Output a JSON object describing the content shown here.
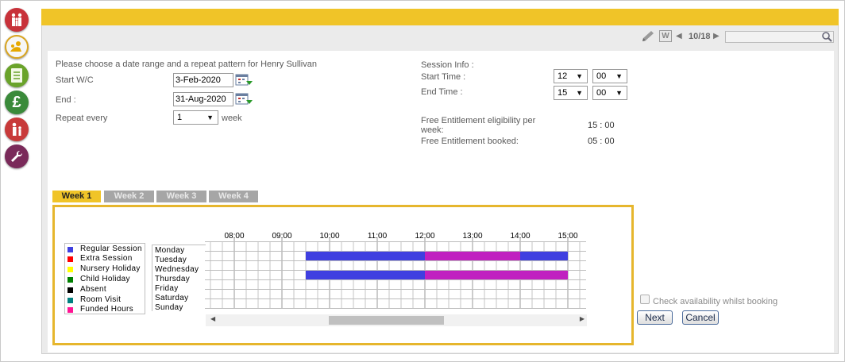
{
  "nav": {
    "items": [
      "family-icon",
      "child-icon",
      "register-icon",
      "finance-icon",
      "staff-icon",
      "settings-icon"
    ],
    "colors": [
      "#c8323a",
      "#f0c428",
      "#6aa32a",
      "#3a8a3a",
      "#c83a3a",
      "#7a2a5a"
    ]
  },
  "toolbar": {
    "page_counter": "10/18",
    "search_value": ""
  },
  "form": {
    "intro": "Please choose a date range and a repeat pattern for Henry Sullivan",
    "start_label": "Start W/C",
    "start_value": "3-Feb-2020",
    "end_label": "End :",
    "end_value": "31-Aug-2020",
    "repeat_label": "Repeat every",
    "repeat_value": "1",
    "repeat_unit": "week"
  },
  "session": {
    "title": "Session Info :",
    "start_label": "Start Time :",
    "start_hour": "12",
    "start_min": "00",
    "end_label": "End Time :",
    "end_hour": "15",
    "end_min": "00",
    "eligibility_label": "Free Entitlement eligibility per week:",
    "eligibility_value": "15 : 00",
    "booked_label": "Free Entitlement booked:",
    "booked_value": "05 : 00"
  },
  "tabs": [
    "Week 1",
    "Week 2",
    "Week 3",
    "Week 4"
  ],
  "active_tab": 0,
  "legend": [
    {
      "label": "Regular Session",
      "color": "#3f3fe0"
    },
    {
      "label": "Extra Session",
      "color": "#ff0000"
    },
    {
      "label": "Nursery Holiday",
      "color": "#ffff00"
    },
    {
      "label": "Child Holiday",
      "color": "#008000"
    },
    {
      "label": "Absent",
      "color": "#000000"
    },
    {
      "label": "Room Visit",
      "color": "#008080"
    },
    {
      "label": "Funded Hours",
      "color": "#ff1493"
    }
  ],
  "schedule": {
    "hours": [
      "08:00",
      "09:00",
      "10:00",
      "11:00",
      "12:00",
      "13:00",
      "14:00",
      "15:00"
    ],
    "days": [
      "Monday",
      "Tuesday",
      "Wednesday",
      "Thursday",
      "Friday",
      "Saturday",
      "Sunday"
    ],
    "bookings": [
      {
        "day": "Tuesday",
        "start": "09:30",
        "end": "12:00",
        "type": "regular"
      },
      {
        "day": "Tuesday",
        "start": "12:00",
        "end": "14:00",
        "type": "funded"
      },
      {
        "day": "Tuesday",
        "start": "14:00",
        "end": "15:00",
        "type": "regular"
      },
      {
        "day": "Thursday",
        "start": "09:30",
        "end": "12:00",
        "type": "regular"
      },
      {
        "day": "Thursday",
        "start": "12:00",
        "end": "15:00",
        "type": "funded"
      }
    ],
    "colors": {
      "regular": "#3f3fe0",
      "funded": "#c020c0"
    }
  },
  "availability_label": "Check availability whilst booking",
  "next_label": "Next",
  "cancel_label": "Cancel"
}
